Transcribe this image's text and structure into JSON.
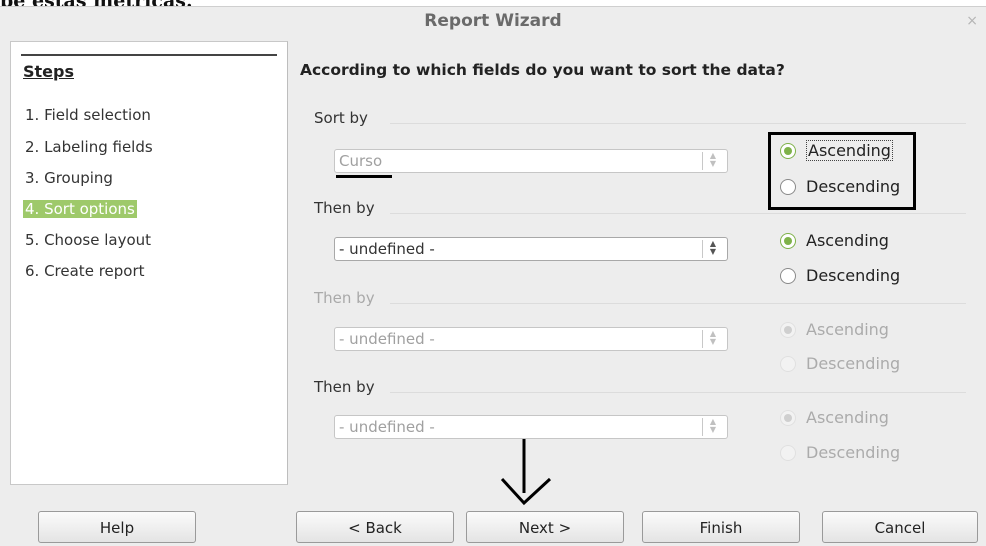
{
  "background_text": "pe estas métricas.",
  "window": {
    "title": "Report Wizard",
    "close_glyph": "×"
  },
  "steps": {
    "title": "Steps",
    "items": [
      {
        "label": "1. Field selection"
      },
      {
        "label": "2. Labeling fields"
      },
      {
        "label": "3. Grouping"
      },
      {
        "label": "4. Sort options",
        "active": true
      },
      {
        "label": "5. Choose layout"
      },
      {
        "label": "6. Create report"
      }
    ]
  },
  "main": {
    "question": "According to which fields do you want to sort the data?",
    "sections": [
      {
        "label": "Sort by",
        "value": "Curso",
        "ascending": "Ascending",
        "descending": "Descending",
        "selected": "Ascending",
        "enabled": true
      },
      {
        "label": "Then by",
        "value": "- undefined -",
        "ascending": "Ascending",
        "descending": "Descending",
        "selected": "Ascending",
        "enabled": true
      },
      {
        "label": "Then by",
        "value": "- undefined -",
        "ascending": "Ascending",
        "descending": "Descending",
        "selected": "Ascending",
        "enabled": false
      },
      {
        "label": "Then by",
        "value": "- undefined -",
        "ascending": "Ascending",
        "descending": "Descending",
        "selected": "Ascending",
        "enabled": false
      }
    ]
  },
  "buttons": {
    "help": "Help",
    "back": "< Back",
    "next": "Next >",
    "finish": "Finish",
    "cancel": "Cancel"
  },
  "colors": {
    "accent": "#7fb24a",
    "active_step_bg": "#9ec96a"
  }
}
